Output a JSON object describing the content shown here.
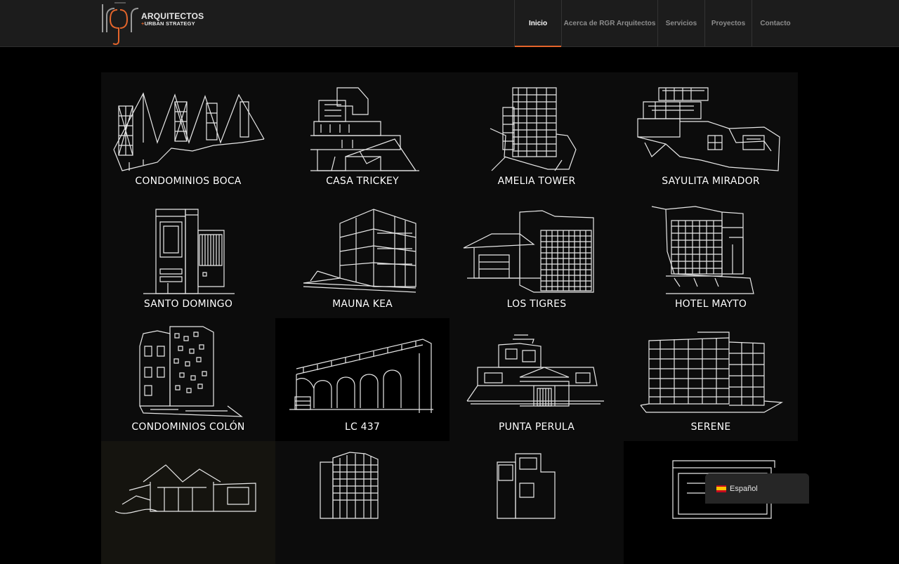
{
  "brand": {
    "line1": "ARQUITECTOS",
    "line2_accent": "+",
    "line2": "URBAN STRATEGY",
    "accent_color": "#e5652b"
  },
  "nav": {
    "items": [
      {
        "label": "Inicio",
        "active": true
      },
      {
        "label": "Acerca de RGR Arquitectos",
        "active": false
      },
      {
        "label": "Servicios",
        "active": false
      },
      {
        "label": "Proyectos",
        "active": false
      },
      {
        "label": "Contacto",
        "active": false
      }
    ]
  },
  "projects": [
    {
      "label": "CONDOMINIOS BOCA"
    },
    {
      "label": "CASA TRICKEY"
    },
    {
      "label": "AMELIA TOWER"
    },
    {
      "label": "SAYULITA MIRADOR"
    },
    {
      "label": "SANTO DOMINGO"
    },
    {
      "label": "MAUNA KEA"
    },
    {
      "label": "LOS TIGRES"
    },
    {
      "label": "HOTEL MAYTO"
    },
    {
      "label": "CONDOMINIOS COLÓN"
    },
    {
      "label": "LC 437"
    },
    {
      "label": "PUNTA PERULA"
    },
    {
      "label": "SERENE"
    },
    {
      "label": ""
    },
    {
      "label": ""
    },
    {
      "label": ""
    },
    {
      "label": ""
    }
  ],
  "language": {
    "label": "Español",
    "flag_icon": "spain-flag-icon"
  }
}
